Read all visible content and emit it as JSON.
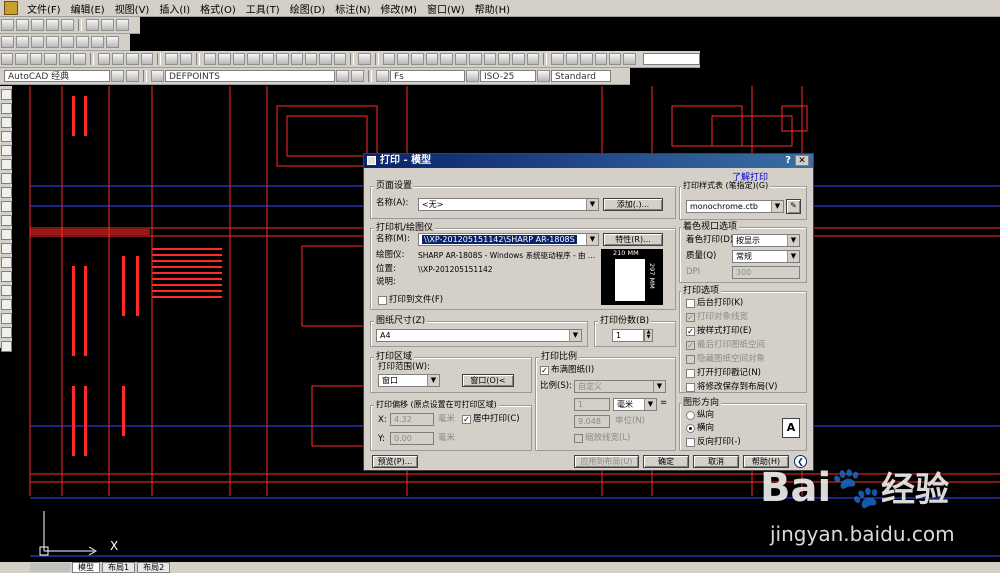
{
  "menu": [
    "文件(F)",
    "编辑(E)",
    "视图(V)",
    "插入(I)",
    "格式(O)",
    "工具(T)",
    "绘图(D)",
    "标注(N)",
    "修改(M)",
    "窗口(W)",
    "帮助(H)"
  ],
  "toolbar": {
    "workspace": "AutoCAD 经典",
    "layer": "DEFPOINTS",
    "text_style": "Fs",
    "dim_style": "ISO-25",
    "table_style": "Standard"
  },
  "layout_tabs": [
    "模型",
    "布局1",
    "布局2"
  ],
  "dialog": {
    "title": "打印 - 模型",
    "help_link": "了解打印",
    "page_setup": {
      "group": "页面设置",
      "name_label": "名称(A):",
      "name_value": "<无>",
      "add_button": "添加(.)..."
    },
    "printer": {
      "group": "打印机/绘图仪",
      "name_label": "名称(M):",
      "name_value": "\\\\XP-201205151142\\SHARP AR-1808S",
      "properties_button": "特性(R)...",
      "plotter_label": "绘图仪:",
      "plotter_value": "SHARP AR-1808S - Windows 系统驱动程序 - 由 ...",
      "location_label": "位置:",
      "location_value": "\\\\XP-201205151142",
      "description_label": "说明:",
      "print_to_file": "打印到文件(F)",
      "preview_width": "210 MM",
      "preview_height": "297 MM"
    },
    "paper_size": {
      "group": "图纸尺寸(Z)",
      "value": "A4"
    },
    "copies": {
      "group": "打印份数(B)",
      "value": "1"
    },
    "plot_area": {
      "group": "打印区域",
      "range_label": "打印范围(W):",
      "range_value": "窗口",
      "window_button": "窗口(O)<"
    },
    "plot_scale": {
      "group": "打印比例",
      "fit_paper": "布满图纸(I)",
      "fit_paper_checked": true,
      "scale_label": "比例(S):",
      "scale_value": "自定义",
      "value1": "1",
      "unit_value": "毫米",
      "value2": "9.048",
      "unit_label": "单位(N)",
      "scale_lineweights": "缩放线宽(L)"
    },
    "plot_offset": {
      "group": "打印偏移 (原点设置在可打印区域)",
      "x_label": "X:",
      "x_value": "4.32",
      "y_label": "Y:",
      "y_value": "0.00",
      "unit_mm": "毫米",
      "center": "居中打印(C)",
      "center_checked": true
    },
    "plot_style_table": {
      "group": "打印样式表 (笔指定)(G)",
      "value": "monochrome.ctb"
    },
    "shaded_viewport": {
      "group": "着色视口选项",
      "shade_label": "着色打印(D)",
      "shade_value": "按显示",
      "quality_label": "质量(Q)",
      "quality_value": "常规",
      "dpi_label": "DPI",
      "dpi_value": "300"
    },
    "plot_options": {
      "group": "打印选项",
      "items": [
        {
          "label": "后台打印(K)",
          "checked": false,
          "enabled": true
        },
        {
          "label": "打印对象线宽",
          "checked": true,
          "enabled": false
        },
        {
          "label": "按样式打印(E)",
          "checked": true,
          "enabled": true
        },
        {
          "label": "最后打印图纸空间",
          "checked": true,
          "enabled": false
        },
        {
          "label": "隐藏图纸空间对象",
          "checked": false,
          "enabled": false
        },
        {
          "label": "打开打印戳记(N)",
          "checked": false,
          "enabled": true
        },
        {
          "label": "将修改保存到布局(V)",
          "checked": false,
          "enabled": true
        }
      ]
    },
    "orientation": {
      "group": "图形方向",
      "portrait": "纵向",
      "landscape": "横向",
      "reverse": "反向打印(-)",
      "selected": "landscape",
      "icon_letter": "A"
    },
    "footer": {
      "preview": "预览(P)...",
      "apply_layout": "应用到布局(U)",
      "ok": "确定",
      "cancel": "取消",
      "help": "帮助(H)"
    }
  },
  "watermark": {
    "logo": "Bai",
    "logo_cn": "经验",
    "url": "jingyan.baidu.com"
  },
  "ucs_label": "X",
  "colors": {
    "cad_background": "#000000",
    "cad_red": "#ff2a2a",
    "dialog_face": "#d4d0c8",
    "titlebar_start": "#0a246a",
    "titlebar_end": "#3a6ea5"
  }
}
